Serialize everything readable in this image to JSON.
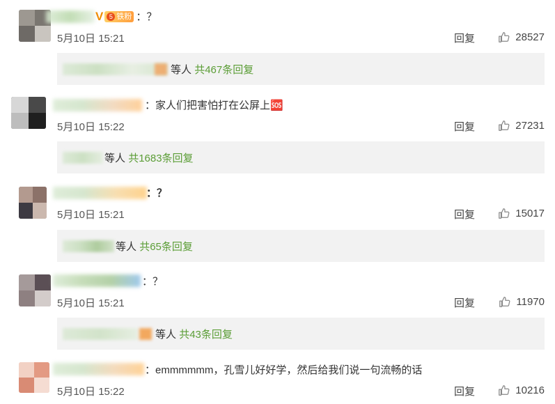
{
  "comments": [
    {
      "username_fragment": "",
      "show_vip": true,
      "vip_symbol": "V",
      "fans_level": "5",
      "fans_label": "铁粉",
      "text": "：？",
      "bold": false,
      "timestamp": "5月10日 15:21",
      "reply_label": "回复",
      "likes": "28527",
      "replies_prefix": "等人",
      "replies_link": "共467条回复"
    },
    {
      "username_fragment": "",
      "show_vip": false,
      "fans_level": "",
      "fans_label": "",
      "text": "：家人们把害怕打在公屏上🆘",
      "bold": false,
      "timestamp": "5月10日 15:22",
      "reply_label": "回复",
      "likes": "27231",
      "replies_prefix": "等人",
      "replies_link": "共1683条回复"
    },
    {
      "username_fragment": "",
      "show_vip": false,
      "fans_level": "",
      "fans_label": "",
      "text": "：？",
      "bold": true,
      "timestamp": "5月10日 15:21",
      "reply_label": "回复",
      "likes": "15017",
      "replies_prefix": "等人",
      "replies_link": "共65条回复"
    },
    {
      "username_fragment": "",
      "show_vip": false,
      "fans_level": "",
      "fans_label": "",
      "text": "：？",
      "bold": false,
      "timestamp": "5月10日 15:21",
      "reply_label": "回复",
      "likes": "11970",
      "replies_prefix": "等人",
      "replies_link": "共43条回复"
    },
    {
      "username_fragment": "",
      "show_vip": false,
      "fans_level": "",
      "fans_label": "",
      "text": "：emmmmmm，孔雪儿好好学，然后给我们说一句流畅的话",
      "bold": false,
      "timestamp": "5月10日 15:22",
      "reply_label": "回复",
      "likes": "10216"
    }
  ],
  "icons": {
    "like": "thumbs-up-icon",
    "vip": "verified-v-icon",
    "fans_badge": "fans-badge-icon"
  },
  "colors": {
    "link_green": "#5b9d36",
    "reply_bg": "#f2f2f2",
    "vip_orange": "#f08c00",
    "text": "#333333",
    "meta": "#555555"
  }
}
